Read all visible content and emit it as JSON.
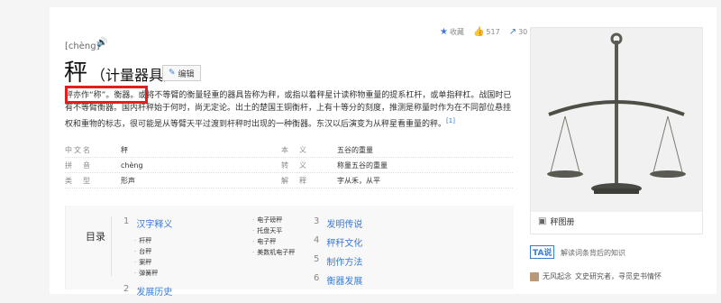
{
  "entry": {
    "pinyin": "[chèng]",
    "title": "秤",
    "subtitle": "（计量器具）",
    "edit_label": "编辑"
  },
  "actions": {
    "favorite_label": "收藏",
    "like_count": "517",
    "share_count": "30"
  },
  "summary": {
    "text": "秤亦作“称”。衡器。或将不等臂的衡量轻重的器具皆称为秤，或指以着秤星计读称物重量的提系杠杆，或单指秤杠。战国时已有不等臂衡器。国内杆秤始于何时，尚无定论。出土的楚国王铜衡杆，上有十等分的刻度，推测是称量时作为在不同部位悬挂权和重物的标志，很可能是从等臂天平过渡到杆秤时出现的一种衡器。东汉以后演变为从秤星看重量的秤。",
    "ref": "[1]"
  },
  "info": [
    {
      "k": "中文名",
      "v": "秤",
      "k2": "本　义",
      "v2": "五谷的重量"
    },
    {
      "k": "拼　音",
      "v": "chèng",
      "k2": "转　义",
      "v2": "称量五谷的重量"
    },
    {
      "k": "类　型",
      "v": "形声",
      "k2": "解　释",
      "v2": "字从禾，从平"
    }
  ],
  "catalog": {
    "label": "目录",
    "col1": [
      {
        "n": "1",
        "t": "汉字释义",
        "subs": [
          "杆秤",
          "台秤",
          "案秤",
          "弹簧秤"
        ]
      },
      {
        "n": "2",
        "t": "发展历史",
        "subs": []
      }
    ],
    "col2_subs": [
      "电子磅秤",
      "托盘天平",
      "电子秤",
      "美数机电子秤"
    ],
    "col3": [
      {
        "n": "3",
        "t": "发明传说"
      },
      {
        "n": "4",
        "t": "秤秆文化"
      },
      {
        "n": "5",
        "t": "制作方法"
      },
      {
        "n": "6",
        "t": "衡器发展"
      }
    ]
  },
  "side": {
    "caption": "秤图册"
  },
  "tashuo": {
    "logo": "TA说",
    "slogan": "解读词条背后的知识",
    "author": "无风起念",
    "author_desc": "文史研究者，寻觅史书情怀"
  }
}
